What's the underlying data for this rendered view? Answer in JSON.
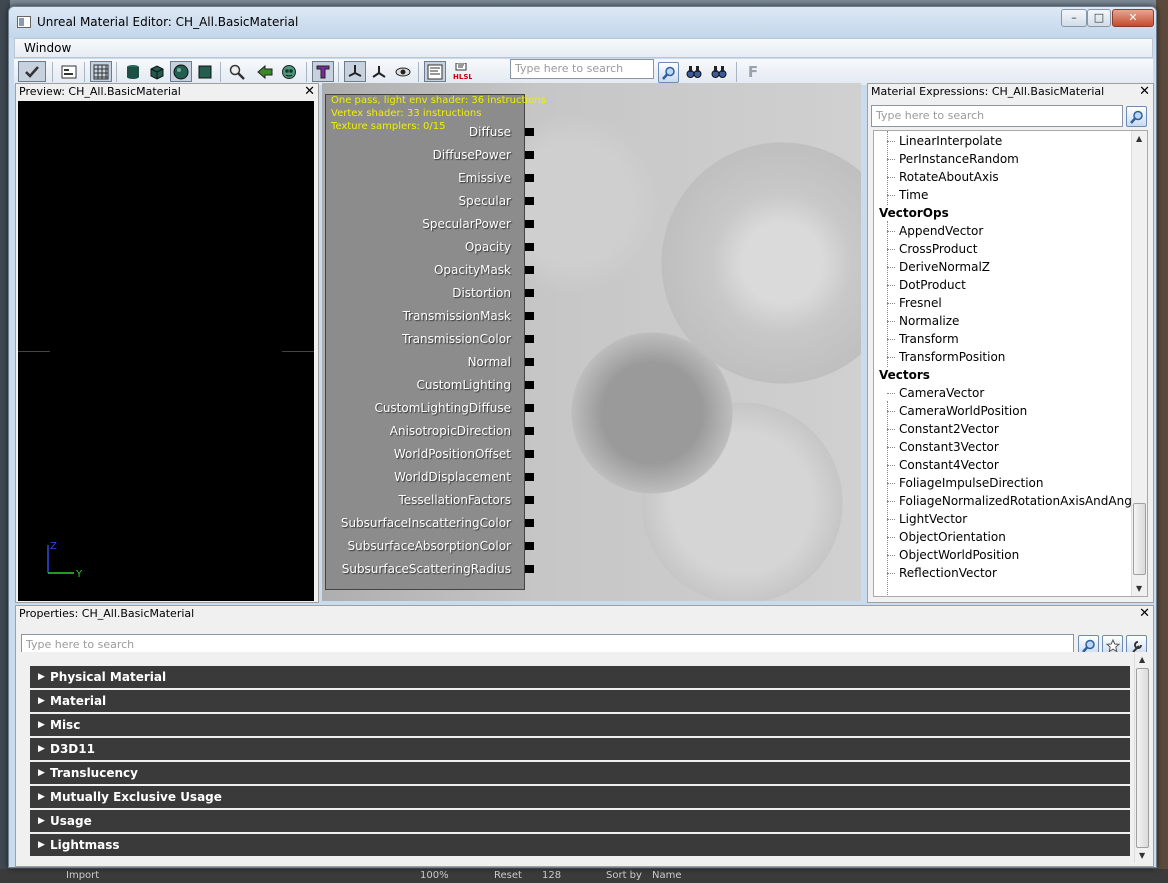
{
  "window": {
    "title": "Unreal Material Editor: CH_All.BasicMaterial",
    "minimize": "–",
    "maximize": "□",
    "close": "✕"
  },
  "menu": {
    "window": "Window"
  },
  "toolbar": {
    "search_placeholder": "Type here to search",
    "hlsl_label": "HLSL",
    "f_label": "F"
  },
  "preview": {
    "title": "Preview: CH_All.BasicMaterial",
    "close": "✕",
    "axis_z": "Z",
    "axis_y": "Y"
  },
  "graph": {
    "info_lines": [
      "One pass, light env shader: 36 instructions",
      "Vertex shader: 33 instructions",
      "Texture samplers: 0/15"
    ],
    "pins": [
      "Diffuse",
      "DiffusePower",
      "Emissive",
      "Specular",
      "SpecularPower",
      "Opacity",
      "OpacityMask",
      "Distortion",
      "TransmissionMask",
      "TransmissionColor",
      "Normal",
      "CustomLighting",
      "CustomLightingDiffuse",
      "AnisotropicDirection",
      "WorldPositionOffset",
      "WorldDisplacement",
      "TessellationFactors",
      "SubsurfaceInscatteringColor",
      "SubsurfaceAbsorptionColor",
      "SubsurfaceScatteringRadius"
    ]
  },
  "expressions": {
    "title": "Material Expressions: CH_All.BasicMaterial",
    "close": "✕",
    "search_placeholder": "Type here to search",
    "rows": [
      {
        "type": "item",
        "label": "LinearInterpolate"
      },
      {
        "type": "item",
        "label": "PerInstanceRandom"
      },
      {
        "type": "item",
        "label": "RotateAboutAxis"
      },
      {
        "type": "item",
        "label": "Time"
      },
      {
        "type": "cat",
        "label": "VectorOps"
      },
      {
        "type": "item",
        "label": "AppendVector"
      },
      {
        "type": "item",
        "label": "CrossProduct"
      },
      {
        "type": "item",
        "label": "DeriveNormalZ"
      },
      {
        "type": "item",
        "label": "DotProduct"
      },
      {
        "type": "item",
        "label": "Fresnel"
      },
      {
        "type": "item",
        "label": "Normalize"
      },
      {
        "type": "item",
        "label": "Transform"
      },
      {
        "type": "item",
        "label": "TransformPosition"
      },
      {
        "type": "cat",
        "label": "Vectors"
      },
      {
        "type": "item",
        "label": "CameraVector"
      },
      {
        "type": "item",
        "label": "CameraWorldPosition"
      },
      {
        "type": "item",
        "label": "Constant2Vector"
      },
      {
        "type": "item",
        "label": "Constant3Vector"
      },
      {
        "type": "item",
        "label": "Constant4Vector"
      },
      {
        "type": "item",
        "label": "FoliageImpulseDirection"
      },
      {
        "type": "item",
        "label": "FoliageNormalizedRotationAxisAndAngle"
      },
      {
        "type": "item",
        "label": "LightVector"
      },
      {
        "type": "item",
        "label": "ObjectOrientation"
      },
      {
        "type": "item",
        "label": "ObjectWorldPosition"
      },
      {
        "type": "item",
        "label": "ReflectionVector"
      }
    ]
  },
  "properties": {
    "title": "Properties: CH_All.BasicMaterial",
    "close": "✕",
    "search_placeholder": "Type here to search",
    "categories": [
      "Physical Material",
      "Material",
      "Misc",
      "D3D11",
      "Translucency",
      "Mutually Exclusive Usage",
      "Usage",
      "Lightmass"
    ]
  },
  "taskbar": {
    "import": "Import",
    "zoom": "100%",
    "reset": "Reset",
    "size": "128",
    "sort_by": "Sort by",
    "name": "Name"
  }
}
